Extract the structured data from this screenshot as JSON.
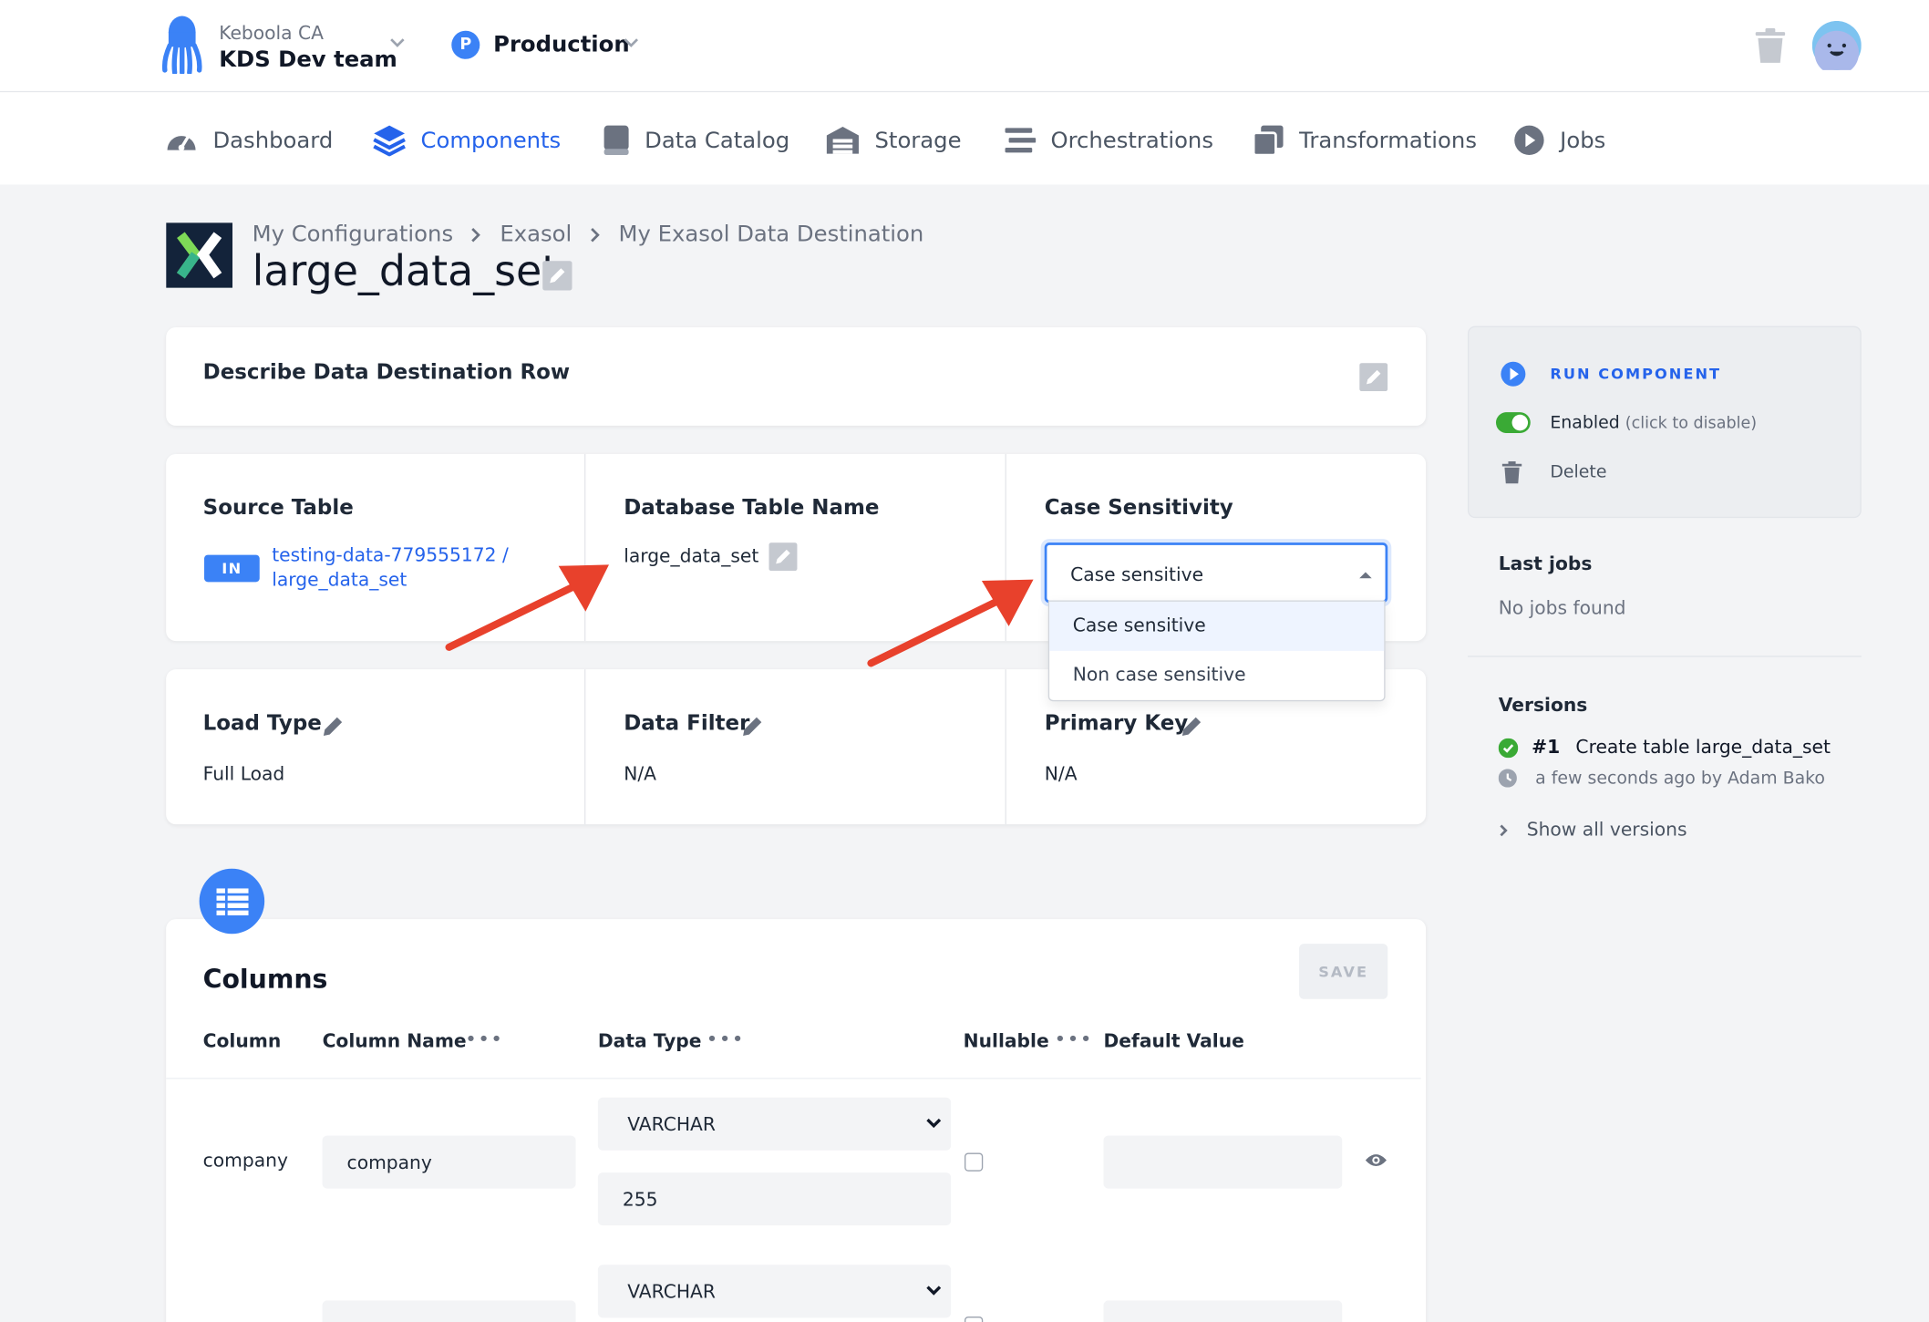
{
  "org": {
    "name": "Keboola CA",
    "team": "KDS Dev team"
  },
  "env": {
    "badge": "P",
    "name": "Production"
  },
  "nav": {
    "dashboard": "Dashboard",
    "components": "Components",
    "data_catalog": "Data Catalog",
    "storage": "Storage",
    "orchestrations": "Orchestrations",
    "transformations": "Transformations",
    "jobs": "Jobs"
  },
  "breadcrumb": {
    "b1": "My Configurations",
    "b2": "Exasol",
    "b3": "My Exasol Data Destination"
  },
  "page_title": "large_data_set",
  "describe": {
    "label": "Describe Data Destination Row"
  },
  "source": {
    "label": "Source Table",
    "badge": "IN",
    "link_line1": "testing-data-779555172 /",
    "link_line2": "large_data_set"
  },
  "db_table": {
    "label": "Database Table Name",
    "value": "large_data_set"
  },
  "case": {
    "label": "Case Sensitivity",
    "selected": "Case sensitive",
    "options": [
      "Case sensitive",
      "Non case sensitive"
    ]
  },
  "load_type": {
    "label": "Load Type",
    "value": "Full Load"
  },
  "data_filter": {
    "label": "Data Filter",
    "value": "N/A"
  },
  "primary_key": {
    "label": "Primary Key",
    "value": "N/A"
  },
  "columns": {
    "title": "Columns",
    "save": "SAVE",
    "headers": {
      "column": "Column",
      "column_name": "Column Name",
      "data_type": "Data Type",
      "nullable": "Nullable",
      "default_value": "Default Value"
    },
    "rows": [
      {
        "column": "company",
        "name": "company",
        "type": "VARCHAR",
        "length": "255",
        "default": ""
      },
      {
        "column": "",
        "name": "",
        "type": "VARCHAR",
        "length": "",
        "default": ""
      }
    ]
  },
  "sidebar": {
    "run": "RUN COMPONENT",
    "enabled": "Enabled",
    "enabled_hint": "(click to disable)",
    "delete": "Delete",
    "last_jobs_title": "Last jobs",
    "last_jobs_empty": "No jobs found",
    "versions_title": "Versions",
    "version_num": "#1",
    "version_desc": "Create table large_data_set",
    "version_meta": "a few seconds ago by Adam Bako",
    "show_all": "Show all versions"
  },
  "colors": {
    "accent": "#2563eb",
    "arrow": "#e8412c",
    "toggle": "#3aaa35",
    "logo_bg": "#13233a"
  }
}
